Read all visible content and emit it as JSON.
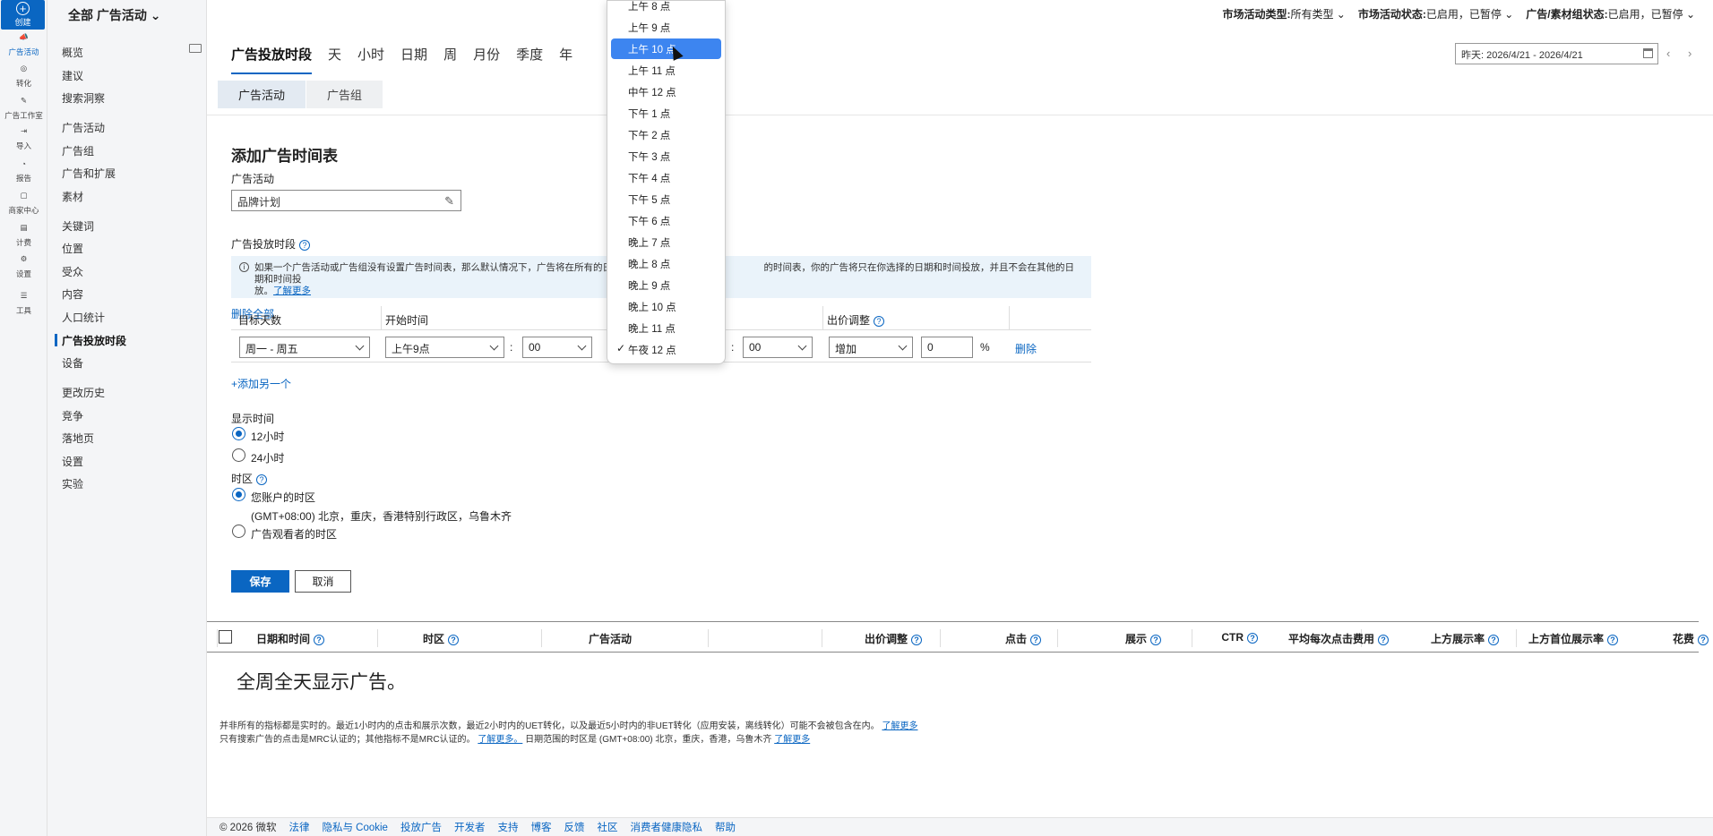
{
  "rail": {
    "create_label": "创建",
    "items": [
      {
        "label": "广告活动",
        "icon": "megaphone-icon",
        "active": true
      },
      {
        "label": "转化",
        "icon": "target-icon"
      },
      {
        "label": "广告工作室",
        "icon": "image-edit-icon"
      },
      {
        "label": "导入",
        "icon": "import-icon"
      },
      {
        "label": "报告",
        "icon": "report-icon"
      },
      {
        "label": "商家中心",
        "icon": "store-icon"
      },
      {
        "label": "计费",
        "icon": "billing-icon"
      },
      {
        "label": "设置",
        "icon": "gear-icon"
      },
      {
        "label": "工具",
        "icon": "tools-icon"
      }
    ]
  },
  "nav": {
    "account": "全部 广告活动",
    "items": [
      "概览",
      "建议",
      "搜索洞察",
      "广告活动",
      "广告组",
      "广告和扩展",
      "素材",
      "关键词",
      "位置",
      "受众",
      "内容",
      "人口统计",
      "广告投放时段",
      "设备",
      "更改历史",
      "竞争",
      "落地页",
      "设置",
      "实验"
    ]
  },
  "filters": {
    "type_label": "市场活动类型:",
    "type_value": "所有类型",
    "status_label": "市场活动状态:",
    "status_value": "已启用，已暂停",
    "ad_status_label": "广告/素材组状态:",
    "ad_status_value": "已启用，已暂停"
  },
  "tabs": [
    "广告投放时段",
    "天",
    "小时",
    "日期",
    "周",
    "月份",
    "季度",
    "年"
  ],
  "date_range": "昨天: 2026/4/21 - 2026/4/21",
  "subtabs": [
    "广告活动",
    "广告组"
  ],
  "form": {
    "title": "添加广告时间表",
    "campaign_label": "广告活动",
    "campaign_value": "品牌计划",
    "schedule_label": "广告投放时段",
    "info_text_1": "如果一个广告活动或广告组没有设置广告时间表，那么默认情况下，广告将在所有的日期和时",
    "info_text_2": "的时间表，你的广告将只在你选择的日期和时间投放，并且不会在其他的日期和时间投",
    "info_text_3": "放。",
    "info_link": "了解更多",
    "cols": {
      "days": "目标天数",
      "start": "开始时间",
      "bid": "出价调整",
      "delete_all": "删除全部"
    },
    "row": {
      "days": "周一 - 周五",
      "start_hour": "上午9点",
      "start_min": "00",
      "end_min": "00",
      "bid_type": "增加",
      "bid_value": "0",
      "pct": "%",
      "delete": "删除"
    },
    "add_more": "+添加另一个",
    "display_time_label": "显示时间",
    "h12": "12小时",
    "h24": "24小时",
    "tz_label": "时区",
    "tz_account": "您账户的时区",
    "tz_account_detail": "(GMT+08:00) 北京，重庆，香港特别行政区，乌鲁木齐",
    "tz_viewer": "广告观看者的时区",
    "save": "保存",
    "cancel": "取消"
  },
  "grid": {
    "cols": [
      "日期和时间",
      "时区",
      "广告活动",
      "出价调整",
      "点击",
      "展示",
      "CTR",
      "平均每次点击费用",
      "上方展示率",
      "上方首位展示率",
      "花费"
    ],
    "empty": "全周全天显示广告。",
    "note1": "并非所有的指标都是实时的。最近1小时内的点击和展示次数，最近2小时内的UET转化，以及最近5小时内的非UET转化（应用安装，离线转化）可能不会被包含在内。",
    "note1_link": "了解更多",
    "note2a": "只有搜索广告的点击是MRC认证的；其他指标不是MRC认证的。",
    "note2_link": "了解更多。",
    "note2b": "日期范围的时区是 (GMT+08:00) 北京，重庆，香港，乌鲁木齐",
    "note2_link2": "了解更多"
  },
  "footer": {
    "copyright": "© 2026 微软",
    "links": [
      "法律",
      "隐私与 Cookie",
      "投放广告",
      "开发者",
      "支持",
      "博客",
      "反馈",
      "社区",
      "消费者健康隐私",
      "帮助"
    ]
  },
  "dropdown": {
    "options": [
      "上午 8 点",
      "上午 9 点",
      "上午 10 点",
      "上午 11 点",
      "中午 12 点",
      "下午 1 点",
      "下午 2 点",
      "下午 3 点",
      "下午 4 点",
      "下午 5 点",
      "下午 6 点",
      "晚上 7 点",
      "晚上 8 点",
      "晚上 9 点",
      "晚上 10 点",
      "晚上 11 点",
      "午夜 12 点"
    ],
    "highlighted": "上午 10 点",
    "checked": "午夜 12 点"
  }
}
